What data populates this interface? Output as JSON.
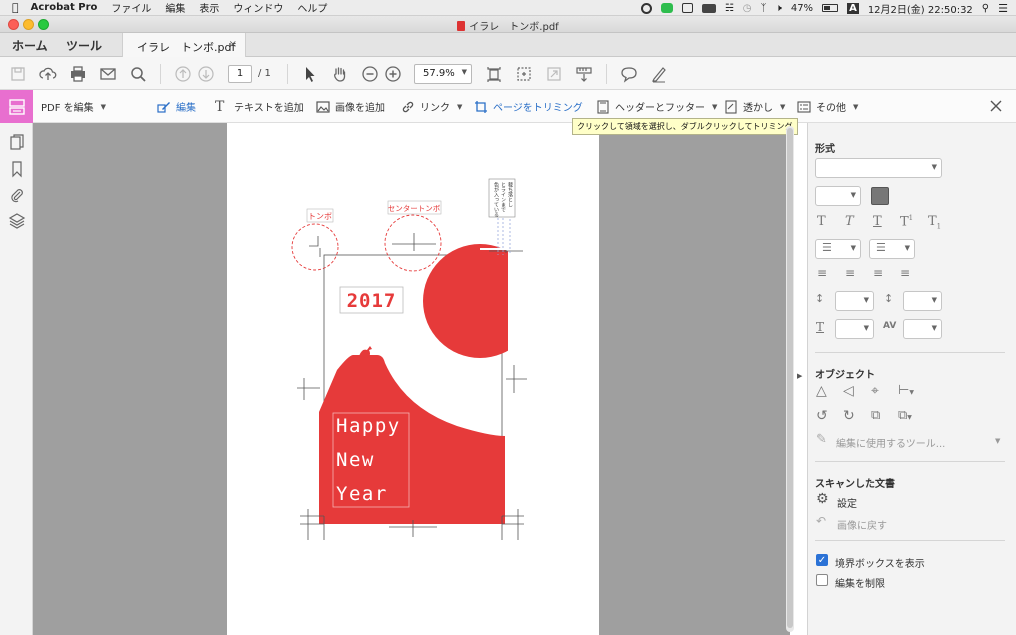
{
  "menubar": {
    "app_name": "Acrobat Pro",
    "menus": [
      "ファイル",
      "編集",
      "表示",
      "ウィンドウ",
      "ヘルプ"
    ],
    "battery": "47%",
    "input_mode": "A",
    "datetime": "12月2日(金)  22:50:32"
  },
  "window": {
    "title": "イラレ　トンボ.pdf"
  },
  "tabs": {
    "home": "ホーム",
    "tools": "ツール",
    "document": "イラレ　トンボ.pdf",
    "close": "×"
  },
  "toolbar": {
    "page_current": "1",
    "page_total": "/ 1",
    "zoom": "57.9%"
  },
  "edit_toolbar": {
    "title": "PDF を編集",
    "edit": "編集",
    "add_text": "テキストを追加",
    "add_image": "画像を追加",
    "link": "リンク",
    "crop": "ページをトリミング",
    "header_footer": "ヘッダーとフッター",
    "watermark": "透かし",
    "more": "その他",
    "tooltip": "クリックして領域を選択し、ダブルクリックしてトリミング"
  },
  "document": {
    "year": "2017",
    "greeting": [
      "Happy",
      "New",
      "Year"
    ],
    "tombo_label": "トンボ",
    "center_tombo_label": "センタートンボ",
    "vertical_note": [
      "裁ち落とし",
      "とラインまで",
      "色が入っている"
    ]
  },
  "right_panel": {
    "format_title": "形式",
    "object_title": "オブジェクト",
    "edit_tool": "編集に使用するツール...",
    "scanned_title": "スキャンした文書",
    "settings": "設定",
    "revert_image": "画像に戻す",
    "show_bbox": "境界ボックスを表示",
    "restrict_edit": "編集を制限",
    "show_bbox_checked": true,
    "restrict_edit_checked": false
  },
  "colors": {
    "accent": "#e63a3a",
    "edit_pink": "#e86fcf",
    "link_blue": "#2a6fc7"
  }
}
